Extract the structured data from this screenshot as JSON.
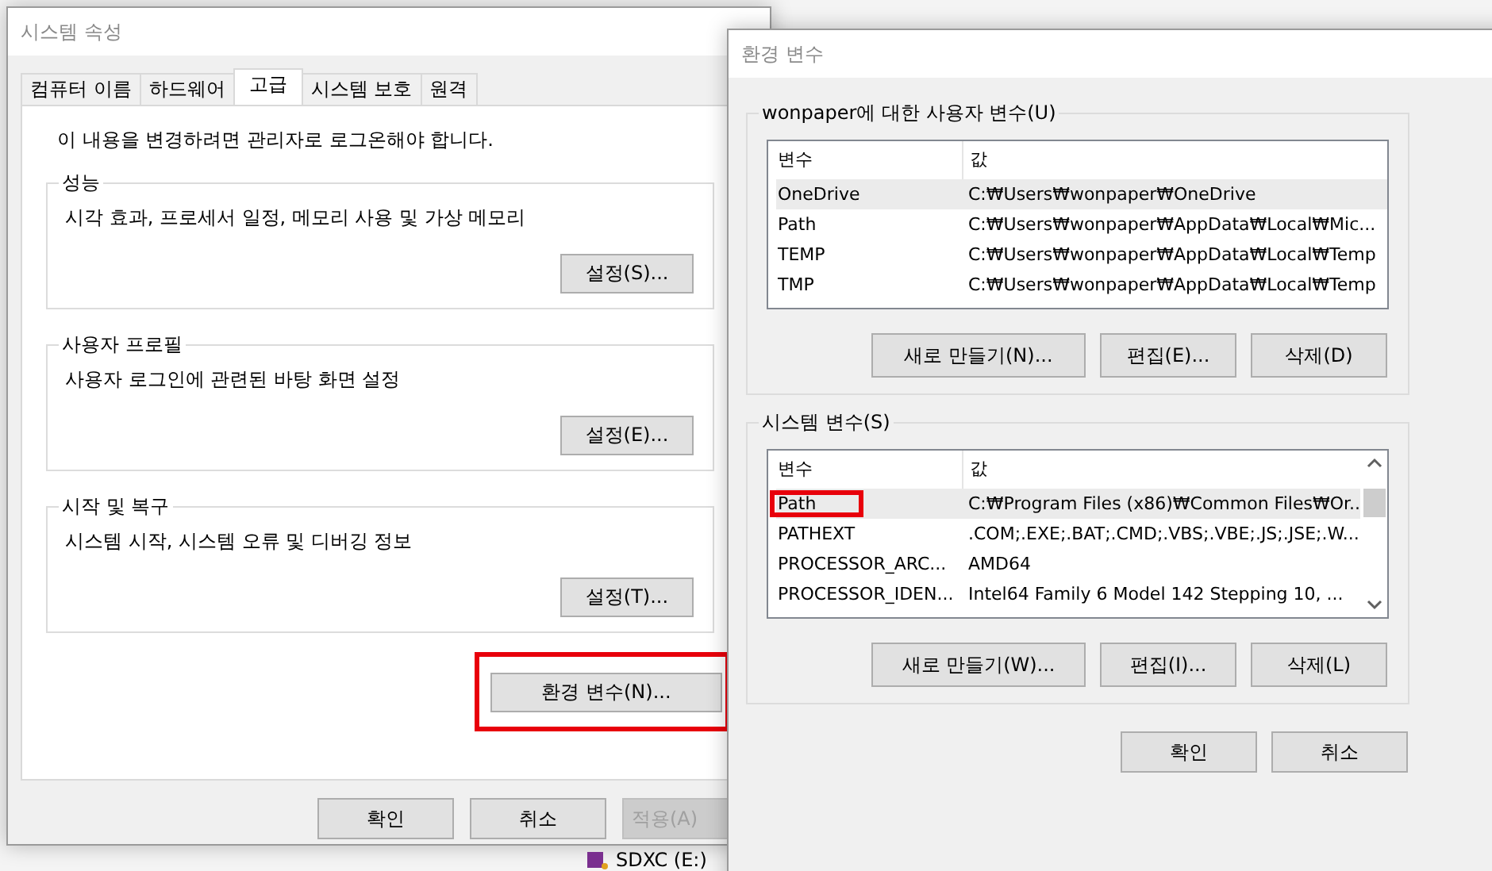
{
  "background": {
    "drive_label": "SDXC (E:)"
  },
  "system_properties": {
    "title": "시스템 속성",
    "tabs": [
      {
        "label": "컴퓨터 이름",
        "selected": false
      },
      {
        "label": "하드웨어",
        "selected": false
      },
      {
        "label": "고급",
        "selected": true
      },
      {
        "label": "시스템 보호",
        "selected": false
      },
      {
        "label": "원격",
        "selected": false
      }
    ],
    "notice": "이 내용을 변경하려면 관리자로 로그온해야 합니다.",
    "groups": [
      {
        "title": "성능",
        "description": "시각 효과, 프로세서 일정, 메모리 사용 및 가상 메모리",
        "button": "설정(S)..."
      },
      {
        "title": "사용자 프로필",
        "description": "사용자 로그인에 관련된 바탕 화면 설정",
        "button": "설정(E)..."
      },
      {
        "title": "시작 및 복구",
        "description": "시스템 시작, 시스템 오류 및 디버깅 정보",
        "button": "설정(T)..."
      }
    ],
    "env_button": {
      "label": "환경 변수(N)...",
      "highlighted": true
    },
    "buttons": [
      {
        "label": "확인",
        "disabled": false
      },
      {
        "label": "취소",
        "disabled": false
      },
      {
        "label": "적용(A)",
        "disabled": true
      }
    ]
  },
  "environment_variables": {
    "title": "환경 변수",
    "sections": [
      {
        "title": "wonpaper에 대한 사용자 변수(U)",
        "columns": [
          "변수",
          "값"
        ],
        "scrollable": false,
        "rows": [
          {
            "name": "OneDrive",
            "value": "C:₩Users₩wonpaper₩OneDrive",
            "selected": true,
            "highlighted": false
          },
          {
            "name": "Path",
            "value": "C:₩Users₩wonpaper₩AppData₩Local₩Mic...",
            "selected": false,
            "highlighted": false
          },
          {
            "name": "TEMP",
            "value": "C:₩Users₩wonpaper₩AppData₩Local₩Temp",
            "selected": false,
            "highlighted": false
          },
          {
            "name": "TMP",
            "value": "C:₩Users₩wonpaper₩AppData₩Local₩Temp",
            "selected": false,
            "highlighted": false
          }
        ],
        "buttons": [
          "새로 만들기(N)...",
          "편집(E)...",
          "삭제(D)"
        ]
      },
      {
        "title": "시스템 변수(S)",
        "columns": [
          "변수",
          "값"
        ],
        "scrollable": true,
        "rows": [
          {
            "name": "Path",
            "value": "C:₩Program Files (x86)₩Common Files₩Or...",
            "selected": true,
            "highlighted": true
          },
          {
            "name": "PATHEXT",
            "value": ".COM;.EXE;.BAT;.CMD;.VBS;.VBE;.JS;.JSE;.W...",
            "selected": false,
            "highlighted": false
          },
          {
            "name": "PROCESSOR_ARC...",
            "value": "AMD64",
            "selected": false,
            "highlighted": false
          },
          {
            "name": "PROCESSOR_IDEN...",
            "value": "Intel64 Family 6 Model 142 Stepping 10, ...",
            "selected": false,
            "highlighted": false
          }
        ],
        "buttons": [
          "새로 만들기(W)...",
          "편집(I)...",
          "삭제(L)"
        ]
      }
    ],
    "buttons": [
      "확인",
      "취소"
    ]
  }
}
